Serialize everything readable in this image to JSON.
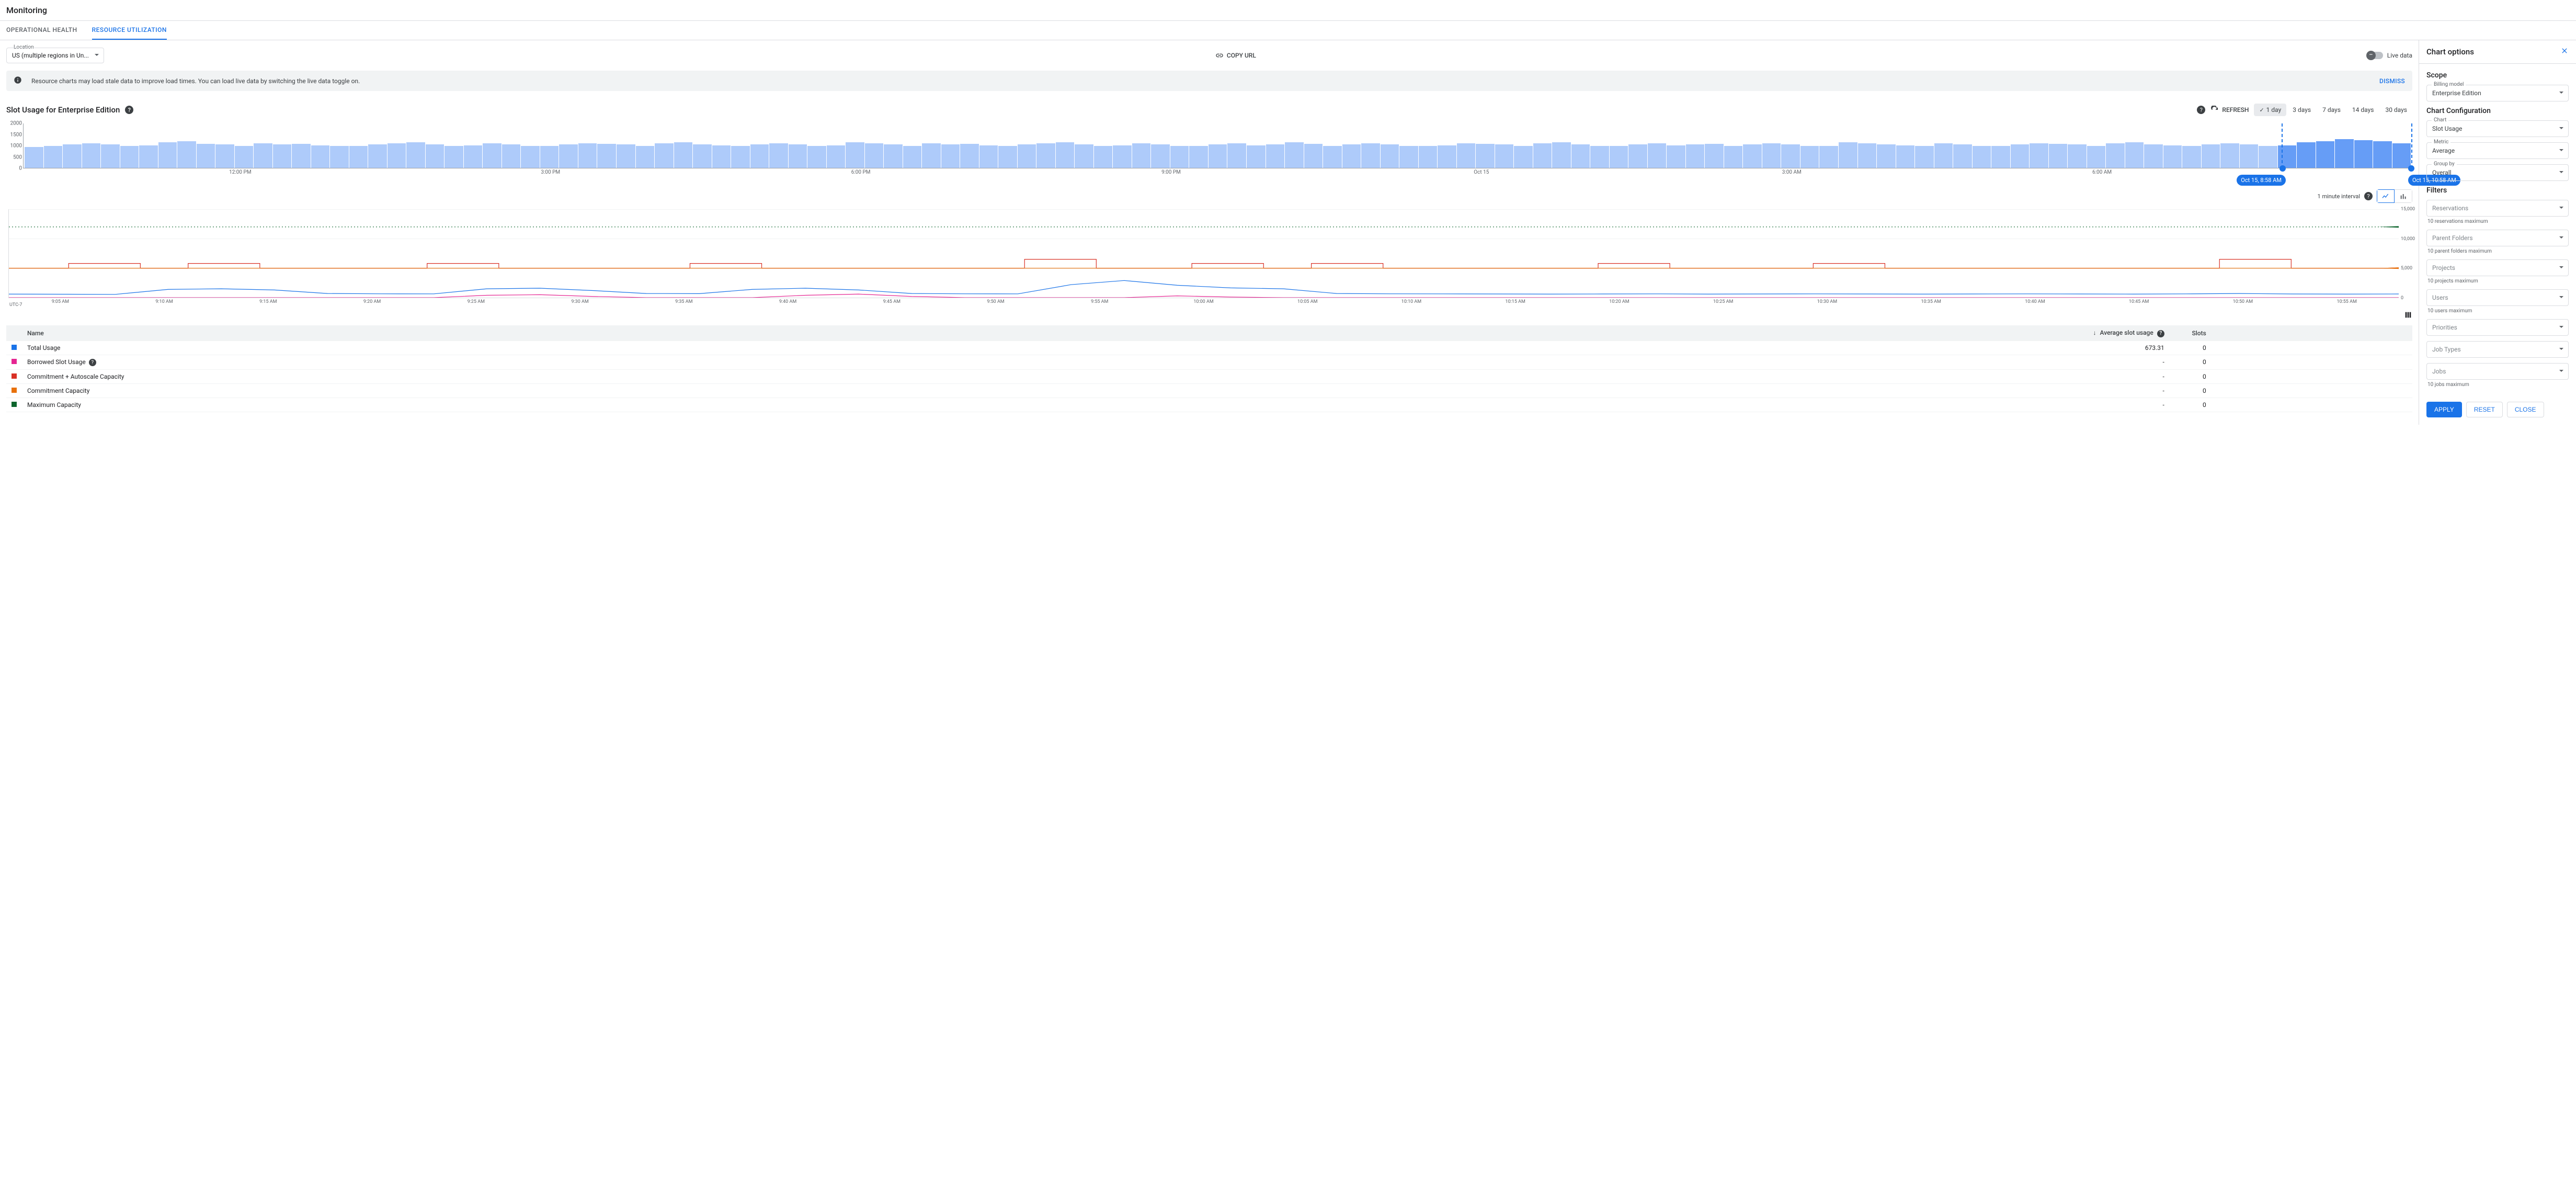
{
  "page_title": "Monitoring",
  "tabs": {
    "operational_health": "OPERATIONAL HEALTH",
    "resource_utilization": "RESOURCE UTILIZATION"
  },
  "toolbar": {
    "location_label": "Location",
    "location_value": "US (multiple regions in Un...",
    "copy_url": "COPY URL",
    "live_data": "Live data"
  },
  "banner": {
    "text": "Resource charts may load stale data to improve load times. You can load live data by switching the live data toggle on.",
    "dismiss": "DISMISS"
  },
  "chart_section": {
    "title": "Slot Usage for Enterprise Edition",
    "refresh": "REFRESH",
    "ranges": [
      "1 day",
      "3 days",
      "7 days",
      "14 days",
      "30 days"
    ],
    "interval_text": "1 minute interval",
    "brush_start": "Oct 15, 8:58 AM",
    "brush_end": "Oct 15, 10:58 AM",
    "tz": "UTC-7"
  },
  "chart_data": {
    "overview": {
      "type": "bar",
      "ylim": [
        0,
        2000
      ],
      "yticks": [
        0,
        500,
        1000,
        1500,
        2000
      ],
      "xticks": [
        "12:00 PM",
        "3:00 PM",
        "6:00 PM",
        "9:00 PM",
        "Oct 15",
        "3:00 AM",
        "6:00 AM"
      ],
      "values": [
        950,
        1000,
        1050,
        1100,
        1050,
        980,
        1020,
        1150,
        1200,
        1080,
        1050,
        1000,
        1100,
        1050,
        1080,
        1020,
        980,
        1000,
        1050,
        1100,
        1150,
        1050,
        1000,
        1020,
        1100,
        1050,
        1000,
        980,
        1050,
        1100,
        1080,
        1050,
        1000,
        1100,
        1150,
        1050,
        1020,
        1000,
        1050,
        1100,
        1050,
        980,
        1020,
        1150,
        1100,
        1050,
        1000,
        1100,
        1050,
        1080,
        1020,
        1000,
        1050,
        1100,
        1150,
        1050,
        1000,
        1020,
        1100,
        1050,
        980,
        1000,
        1050,
        1100,
        1020,
        1050,
        1150,
        1080,
        1000,
        1050,
        1100,
        1050,
        1000,
        980,
        1020,
        1100,
        1080,
        1050,
        1000,
        1100,
        1150,
        1050,
        980,
        1000,
        1050,
        1100,
        1020,
        1050,
        1080,
        1000,
        1050,
        1100,
        1050,
        980,
        1000,
        1150,
        1100,
        1050,
        1020,
        1000,
        1100,
        1050,
        1000,
        980,
        1050,
        1100,
        1080,
        1050,
        1000,
        1100,
        1150,
        1050,
        1020,
        1000,
        1050,
        1100,
        1050,
        980,
        1020,
        1150,
        1200,
        1300,
        1250,
        1200,
        1100
      ],
      "selected_from_index": 118
    },
    "detail": {
      "type": "line",
      "ylim": [
        0,
        15000
      ],
      "yticks": [
        0,
        5000,
        10000,
        15000
      ],
      "xticks": [
        "9:05 AM",
        "9:10 AM",
        "9:15 AM",
        "9:20 AM",
        "9:25 AM",
        "9:30 AM",
        "9:35 AM",
        "9:40 AM",
        "9:45 AM",
        "9:50 AM",
        "9:55 AM",
        "10:00 AM",
        "10:05 AM",
        "10:10 AM",
        "10:15 AM",
        "10:20 AM",
        "10:25 AM",
        "10:30 AM",
        "10:35 AM",
        "10:40 AM",
        "10:45 AM",
        "10:50 AM",
        "10:55 AM"
      ],
      "series": [
        {
          "name": "Maximum Capacity",
          "color": "#0d652d",
          "style": "dotted",
          "constant": 12000
        },
        {
          "name": "Commitment + Autoscale Capacity",
          "color": "#d93025",
          "baseline": 5000,
          "bumps": [
            [
              0.04,
              5800
            ],
            [
              0.09,
              5800
            ],
            [
              0.19,
              5800
            ],
            [
              0.3,
              5800
            ],
            [
              0.44,
              6500
            ],
            [
              0.51,
              5800
            ],
            [
              0.56,
              5800
            ],
            [
              0.68,
              5800
            ],
            [
              0.77,
              5800
            ],
            [
              0.94,
              6500
            ]
          ]
        },
        {
          "name": "Commitment Capacity",
          "color": "#e8710a",
          "constant": 5000
        },
        {
          "name": "Total Usage",
          "color": "#1a73e8",
          "values": [
            600,
            580,
            550,
            1400,
            1500,
            1300,
            700,
            650,
            640,
            1500,
            1600,
            1200,
            700,
            680,
            1400,
            1600,
            1300,
            700,
            650,
            640,
            2200,
            2900,
            2100,
            1650,
            1500,
            700,
            650,
            640,
            620,
            600,
            620,
            640,
            600,
            620,
            640,
            620,
            600,
            620,
            640,
            620,
            600,
            640,
            700,
            620,
            600,
            620
          ]
        },
        {
          "name": "Borrowed Slot Usage",
          "color": "#e52592",
          "values": [
            0,
            0,
            0,
            0,
            0,
            0,
            0,
            0,
            0,
            400,
            500,
            200,
            0,
            0,
            0,
            400,
            600,
            200,
            0,
            0,
            0,
            0,
            300,
            100,
            0,
            0,
            0,
            0,
            0,
            0,
            0,
            0,
            0,
            0,
            0,
            0,
            0,
            0,
            0,
            0,
            0,
            0,
            0,
            0,
            0,
            0
          ]
        }
      ]
    }
  },
  "legend_table": {
    "headers": {
      "name": "Name",
      "avg": "Average slot usage",
      "slots": "Slots"
    },
    "rows": [
      {
        "name": "Total Usage",
        "color": "#1a73e8",
        "avg": "673.31",
        "slots": "0"
      },
      {
        "name": "Borrowed Slot Usage",
        "color": "#e52592",
        "avg": "-",
        "slots": "0",
        "help": true
      },
      {
        "name": "Commitment + Autoscale Capacity",
        "color": "#d93025",
        "avg": "-",
        "slots": "0"
      },
      {
        "name": "Commitment Capacity",
        "color": "#e8710a",
        "avg": "-",
        "slots": "0"
      },
      {
        "name": "Maximum Capacity",
        "color": "#0d652d",
        "avg": "-",
        "slots": "0"
      }
    ]
  },
  "options_panel": {
    "title": "Chart options",
    "sections": {
      "scope": "Scope",
      "chart_config": "Chart Configuration",
      "filters": "Filters"
    },
    "fields": {
      "billing_model": {
        "label": "Billing model",
        "value": "Enterprise Edition"
      },
      "chart": {
        "label": "Chart",
        "value": "Slot Usage"
      },
      "metric": {
        "label": "Metric",
        "value": "Average"
      },
      "group_by": {
        "label": "Group by",
        "value": "Overall"
      },
      "reservations": {
        "placeholder": "Reservations",
        "helper": "10 reservations maximum"
      },
      "parent_folders": {
        "placeholder": "Parent Folders",
        "helper": "10 parent folders maximum"
      },
      "projects": {
        "placeholder": "Projects",
        "helper": "10 projects maximum"
      },
      "users": {
        "placeholder": "Users",
        "helper": "10 users maximum"
      },
      "priorities": {
        "placeholder": "Priorities"
      },
      "job_types": {
        "placeholder": "Job Types"
      },
      "jobs": {
        "placeholder": "Jobs",
        "helper": "10 jobs maximum"
      }
    },
    "buttons": {
      "apply": "APPLY",
      "reset": "RESET",
      "close": "CLOSE"
    }
  }
}
